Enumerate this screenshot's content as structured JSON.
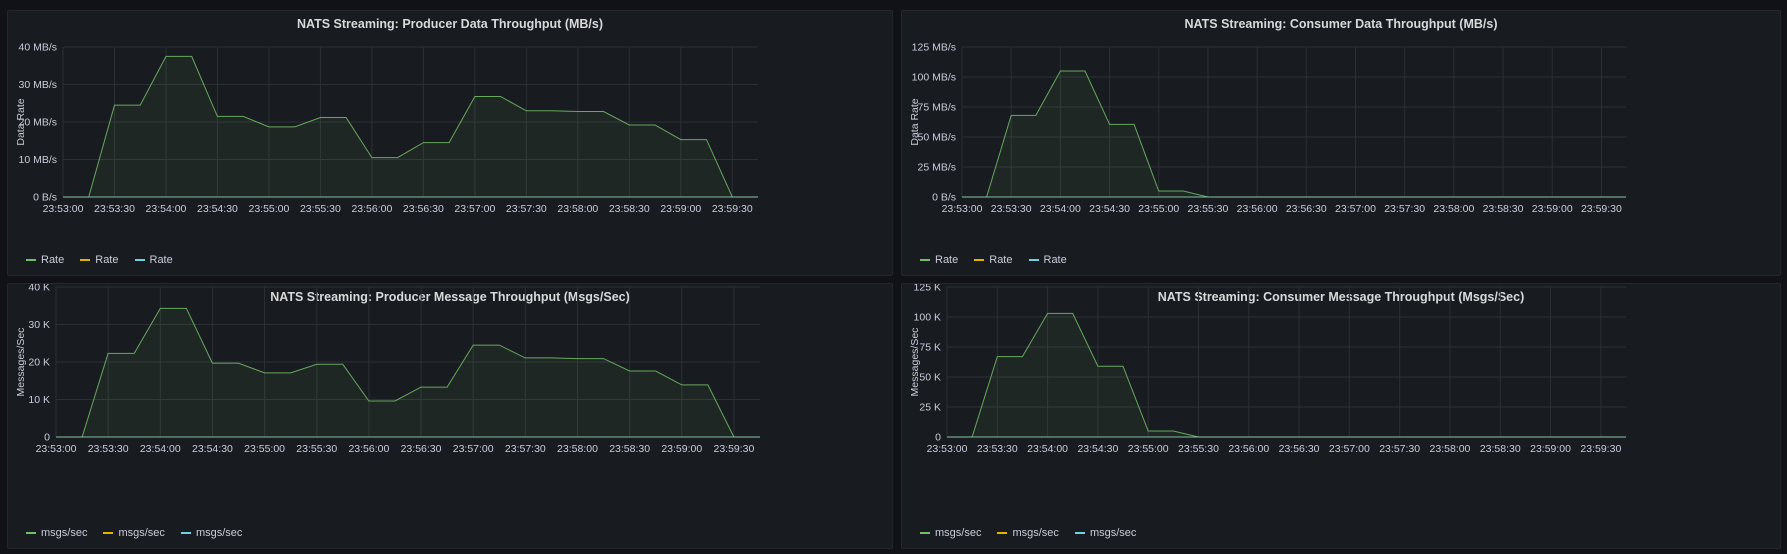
{
  "colors": {
    "series_green": "#73bf69",
    "series_yellow": "#e0b400",
    "series_teal": "#6ed0e0",
    "grid": "#2c3035"
  },
  "panels": [
    {
      "title": "NATS Streaming: Producer Data Throughput (MB/s)",
      "legend": [
        "Rate",
        "Rate",
        "Rate"
      ]
    },
    {
      "title": "NATS Streaming: Consumer Data Throughput (MB/s)",
      "legend": [
        "Rate",
        "Rate",
        "Rate"
      ]
    },
    {
      "title": "NATS Streaming: Producer Message Throughput (Msgs/Sec)",
      "legend": [
        "msgs/sec",
        "msgs/sec",
        "msgs/sec"
      ]
    },
    {
      "title": "NATS Streaming: Consumer Message Throughput (Msgs/Sec)",
      "legend": [
        "msgs/sec",
        "msgs/sec",
        "msgs/sec"
      ]
    }
  ],
  "chart_data": [
    {
      "type": "area",
      "title": "NATS Streaming: Producer Data Throughput (MB/s)",
      "ylabel": "Data Rate",
      "ylim": [
        0,
        40
      ],
      "yticks": [
        0,
        10,
        20,
        30,
        40
      ],
      "ytick_labels": [
        "0 B/s",
        "10 MB/s",
        "20 MB/s",
        "30 MB/s",
        "40 MB/s"
      ],
      "xlim": [
        "23:53:00",
        "23:59:45"
      ],
      "xtick_labels": [
        "23:53:00",
        "23:53:30",
        "23:54:00",
        "23:54:30",
        "23:55:00",
        "23:55:30",
        "23:56:00",
        "23:56:30",
        "23:57:00",
        "23:57:30",
        "23:58:00",
        "23:58:30",
        "23:59:00",
        "23:59:30"
      ],
      "grid": true,
      "legend_position": "bottom-left",
      "series": [
        {
          "name": "Rate",
          "color": "#73bf69",
          "x": [
            "23:53:00",
            "23:53:15",
            "23:53:30",
            "23:53:45",
            "23:54:00",
            "23:54:15",
            "23:54:30",
            "23:54:45",
            "23:55:00",
            "23:55:15",
            "23:55:30",
            "23:55:45",
            "23:56:00",
            "23:56:15",
            "23:56:30",
            "23:56:45",
            "23:57:00",
            "23:57:15",
            "23:57:30",
            "23:57:45",
            "23:58:00",
            "23:58:15",
            "23:58:30",
            "23:58:45",
            "23:59:00",
            "23:59:15",
            "23:59:30",
            "23:59:45"
          ],
          "y": [
            0,
            0,
            24.5,
            24.5,
            37.5,
            37.5,
            21.5,
            21.5,
            18.7,
            18.7,
            21.2,
            21.2,
            10.5,
            10.5,
            14.5,
            14.5,
            26.8,
            26.8,
            23,
            23,
            22.8,
            22.8,
            19.2,
            19.2,
            15.3,
            15.3,
            0,
            0
          ]
        },
        {
          "name": "Rate",
          "color": "#e0b400",
          "x": [
            "23:53:00",
            "23:59:45"
          ],
          "y": [
            0,
            0
          ]
        },
        {
          "name": "Rate",
          "color": "#6ed0e0",
          "x": [
            "23:53:00",
            "23:59:45"
          ],
          "y": [
            0,
            0
          ]
        }
      ]
    },
    {
      "type": "area",
      "title": "NATS Streaming: Consumer Data Throughput (MB/s)",
      "ylabel": "Data Rate",
      "ylim": [
        0,
        125
      ],
      "yticks": [
        0,
        25,
        50,
        75,
        100,
        125
      ],
      "ytick_labels": [
        "0 B/s",
        "25 MB/s",
        "50 MB/s",
        "75 MB/s",
        "100 MB/s",
        "125 MB/s"
      ],
      "xlim": [
        "23:53:00",
        "23:59:45"
      ],
      "xtick_labels": [
        "23:53:00",
        "23:53:30",
        "23:54:00",
        "23:54:30",
        "23:55:00",
        "23:55:30",
        "23:56:00",
        "23:56:30",
        "23:57:00",
        "23:57:30",
        "23:58:00",
        "23:58:30",
        "23:59:00",
        "23:59:30"
      ],
      "grid": true,
      "legend_position": "bottom-left",
      "series": [
        {
          "name": "Rate",
          "color": "#73bf69",
          "x": [
            "23:53:00",
            "23:53:15",
            "23:53:30",
            "23:53:45",
            "23:54:00",
            "23:54:15",
            "23:54:30",
            "23:54:45",
            "23:55:00",
            "23:55:15",
            "23:55:30",
            "23:59:45"
          ],
          "y": [
            0,
            0,
            68,
            68,
            105,
            105,
            60.5,
            60.5,
            5,
            5,
            0,
            0
          ]
        },
        {
          "name": "Rate",
          "color": "#e0b400",
          "x": [
            "23:53:00",
            "23:59:45"
          ],
          "y": [
            0,
            0
          ]
        },
        {
          "name": "Rate",
          "color": "#6ed0e0",
          "x": [
            "23:53:00",
            "23:59:45"
          ],
          "y": [
            0,
            0
          ]
        }
      ]
    },
    {
      "type": "area",
      "title": "NATS Streaming: Producer Message Throughput (Msgs/Sec)",
      "ylabel": "Messages/Sec",
      "ylim": [
        0,
        40
      ],
      "yticks": [
        0,
        10,
        20,
        30,
        40
      ],
      "ytick_labels": [
        "0",
        "10 K",
        "20 K",
        "30 K",
        "40 K"
      ],
      "xlim": [
        "23:53:00",
        "23:59:45"
      ],
      "xtick_labels": [
        "23:53:00",
        "23:53:30",
        "23:54:00",
        "23:54:30",
        "23:55:00",
        "23:55:30",
        "23:56:00",
        "23:56:30",
        "23:57:00",
        "23:57:30",
        "23:58:00",
        "23:58:30",
        "23:59:00",
        "23:59:30"
      ],
      "grid": true,
      "legend_position": "bottom-left",
      "series": [
        {
          "name": "msgs/sec",
          "color": "#73bf69",
          "x": [
            "23:53:00",
            "23:53:15",
            "23:53:30",
            "23:53:45",
            "23:54:00",
            "23:54:15",
            "23:54:30",
            "23:54:45",
            "23:55:00",
            "23:55:15",
            "23:55:30",
            "23:55:45",
            "23:56:00",
            "23:56:15",
            "23:56:30",
            "23:56:45",
            "23:57:00",
            "23:57:15",
            "23:57:30",
            "23:57:45",
            "23:58:00",
            "23:58:15",
            "23:58:30",
            "23:58:45",
            "23:59:00",
            "23:59:15",
            "23:59:30",
            "23:59:45"
          ],
          "y": [
            0,
            0,
            22.3,
            22.3,
            34.3,
            34.3,
            19.7,
            19.7,
            17.1,
            17.1,
            19.4,
            19.4,
            9.6,
            9.6,
            13.3,
            13.3,
            24.5,
            24.5,
            21.1,
            21.1,
            20.9,
            20.9,
            17.6,
            17.6,
            13.9,
            13.9,
            0,
            0
          ]
        },
        {
          "name": "msgs/sec",
          "color": "#e0b400",
          "x": [
            "23:53:00",
            "23:59:45"
          ],
          "y": [
            0,
            0
          ]
        },
        {
          "name": "msgs/sec",
          "color": "#6ed0e0",
          "x": [
            "23:53:00",
            "23:59:45"
          ],
          "y": [
            0,
            0
          ]
        }
      ]
    },
    {
      "type": "area",
      "title": "NATS Streaming: Consumer Message Throughput (Msgs/Sec)",
      "ylabel": "Messages/Sec",
      "ylim": [
        0,
        125
      ],
      "yticks": [
        0,
        25,
        50,
        75,
        100,
        125
      ],
      "ytick_labels": [
        "0",
        "25 K",
        "50 K",
        "75 K",
        "100 K",
        "125 K"
      ],
      "xlim": [
        "23:53:00",
        "23:59:45"
      ],
      "xtick_labels": [
        "23:53:00",
        "23:53:30",
        "23:54:00",
        "23:54:30",
        "23:55:00",
        "23:55:30",
        "23:56:00",
        "23:56:30",
        "23:57:00",
        "23:57:30",
        "23:58:00",
        "23:58:30",
        "23:59:00",
        "23:59:30"
      ],
      "grid": true,
      "legend_position": "bottom-left",
      "series": [
        {
          "name": "msgs/sec",
          "color": "#73bf69",
          "x": [
            "23:53:00",
            "23:53:15",
            "23:53:30",
            "23:53:45",
            "23:54:00",
            "23:54:15",
            "23:54:30",
            "23:54:45",
            "23:55:00",
            "23:55:15",
            "23:55:30",
            "23:59:45"
          ],
          "y": [
            0,
            0,
            67,
            67,
            103,
            103,
            59,
            59,
            5,
            5,
            0,
            0
          ]
        },
        {
          "name": "msgs/sec",
          "color": "#e0b400",
          "x": [
            "23:53:00",
            "23:59:45"
          ],
          "y": [
            0,
            0
          ]
        },
        {
          "name": "msgs/sec",
          "color": "#6ed0e0",
          "x": [
            "23:53:00",
            "23:59:45"
          ],
          "y": [
            0,
            0
          ]
        }
      ]
    }
  ]
}
